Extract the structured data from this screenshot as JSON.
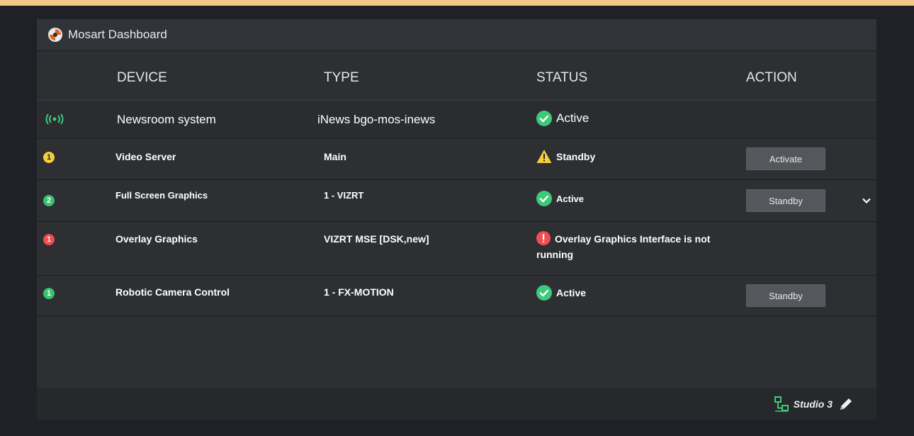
{
  "app": {
    "title": "Mosart Dashboard"
  },
  "columns": {
    "device": "DEVICE",
    "type": "TYPE",
    "status": "STATUS",
    "action": "ACTION"
  },
  "main_row": {
    "device": "Newsroom system",
    "type": "iNews bgo-mos-inews",
    "status": "Active",
    "icon": "broadcast-icon"
  },
  "rows": [
    {
      "badge": "1",
      "badge_color": "#f6cd3d",
      "device": "Video Server",
      "type": "Main",
      "status": "Standby",
      "status_icon": "warning-icon",
      "action": "Activate"
    },
    {
      "badge": "2",
      "badge_color": "#38c36f",
      "device": "Full Screen Graphics",
      "type": "1 - VIZRT",
      "status": "Active",
      "status_icon": "check-icon",
      "action": "Standby"
    },
    {
      "badge": "1",
      "badge_color": "#f04e50",
      "device": "Overlay Graphics",
      "type": "VIZRT MSE [DSK,new]",
      "status": "Overlay Graphics Interface is not running",
      "status_icon": "error-icon",
      "action": ""
    },
    {
      "badge": "1",
      "badge_color": "#38c36f",
      "device": "Robotic Camera Control",
      "type": "1 - FX-MOTION",
      "status": "Active",
      "status_icon": "check-icon",
      "action": "Standby"
    }
  ],
  "footer": {
    "studio": "Studio 3"
  },
  "colors": {
    "active": "#3ec97a",
    "warning": "#f6cd3d",
    "error": "#f04e50",
    "accent_orange": "#f3c98b"
  }
}
